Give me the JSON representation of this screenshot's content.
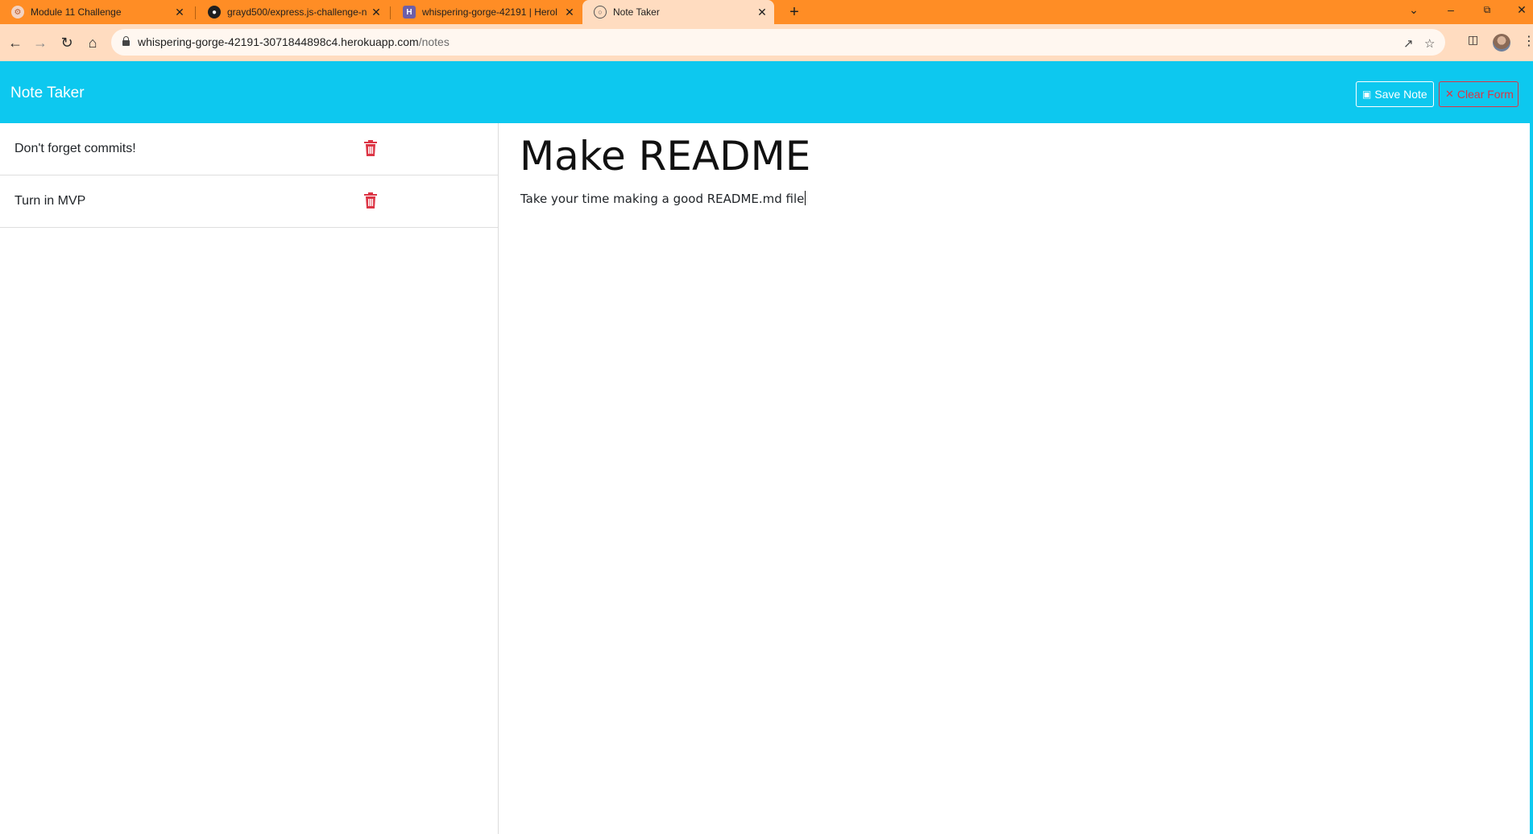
{
  "browser": {
    "tabs": [
      {
        "title": "Module 11 Challenge",
        "icon": "bootcamp-favicon-icon"
      },
      {
        "title": "grayd500/express.js-challenge-n",
        "icon": "github-favicon-icon"
      },
      {
        "title": "whispering-gorge-42191 | Herol",
        "icon": "heroku-favicon-icon"
      },
      {
        "title": "Note Taker",
        "icon": "globe-favicon-icon",
        "active": true
      }
    ],
    "address": {
      "host": "whispering-gorge-42191-3071844898c4.herokuapp.com",
      "path": "/notes"
    },
    "colors": {
      "tabstrip": "#ff8d25",
      "toolbar": "#ffdcc0"
    }
  },
  "app": {
    "brand": "Note Taker",
    "save_label": "Save Note",
    "clear_label": "Clear Form",
    "colors": {
      "navbar": "#0dc8ef",
      "danger": "#dc3545"
    }
  },
  "notes": [
    {
      "title": "Don't forget commits!"
    },
    {
      "title": "Turn in MVP"
    }
  ],
  "active_note": {
    "title": "Make README",
    "text": "Take your time making a good README.md file"
  }
}
